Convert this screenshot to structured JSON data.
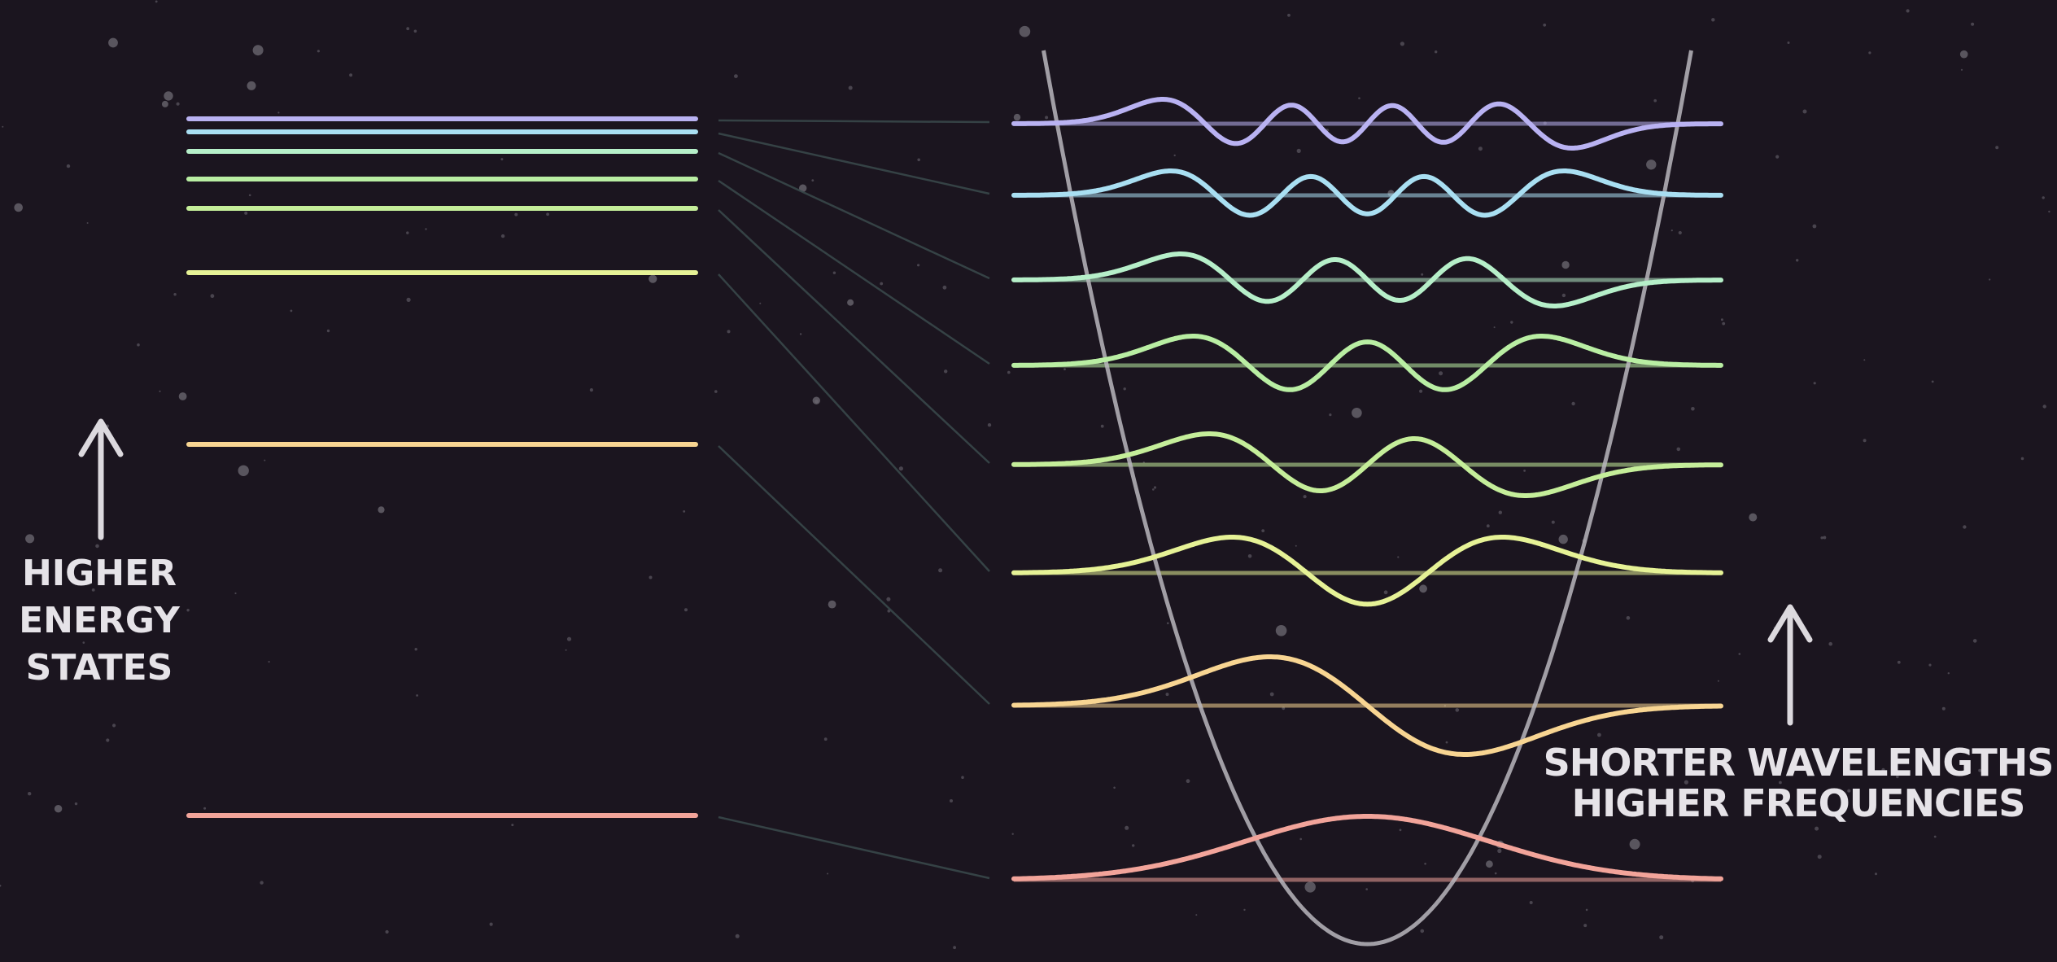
{
  "captions": {
    "energy": "HIGHER\nENERGY\nSTATES",
    "wavelength": "SHORTER WAVELENGTHS\nHIGHER FREQUENCIES"
  },
  "colors": {
    "background": "#1b151f",
    "potential_well": "#b9b6bd",
    "arrow": "#dcd9de",
    "connector": "#3a4a4c",
    "star": "#6f6b74"
  },
  "states": [
    {
      "n": 0,
      "color": "#f2a49a"
    },
    {
      "n": 1,
      "color": "#f8d592"
    },
    {
      "n": 2,
      "color": "#e6f296"
    },
    {
      "n": 3,
      "color": "#c5ee9a"
    },
    {
      "n": 4,
      "color": "#b9eea3"
    },
    {
      "n": 5,
      "color": "#b6efc9"
    },
    {
      "n": 6,
      "color": "#a9dff2"
    },
    {
      "n": 7,
      "color": "#b9b2f2"
    }
  ]
}
